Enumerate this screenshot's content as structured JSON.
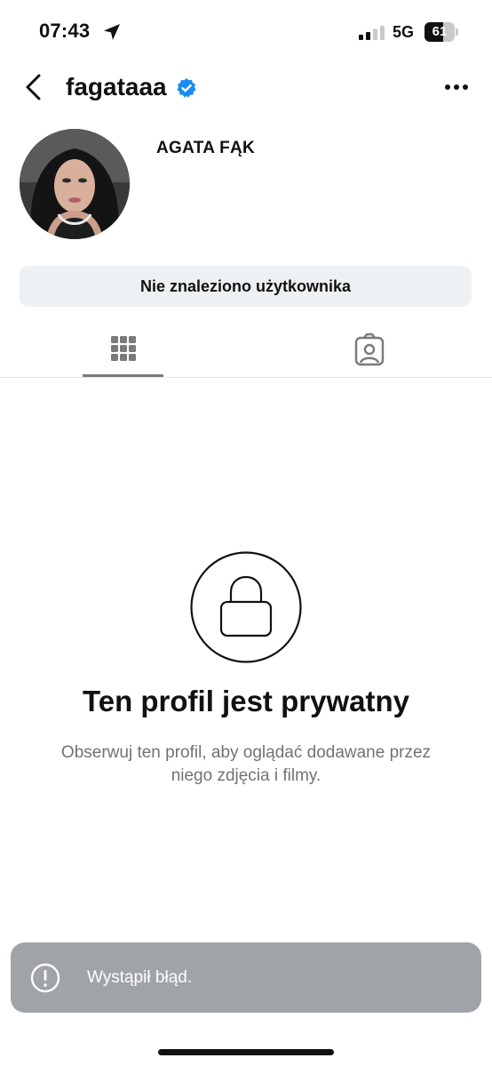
{
  "status_bar": {
    "time": "07:43",
    "network": "5G",
    "battery": "61",
    "battery_level": 0.61
  },
  "header": {
    "username": "fagataaa",
    "verified": true
  },
  "profile": {
    "full_name": "AGATA FĄK",
    "action_button_label": "Nie znaleziono użytkownika"
  },
  "tabs": [
    {
      "icon": "grid-icon",
      "active": true
    },
    {
      "icon": "tagged-icon",
      "active": false
    }
  ],
  "private": {
    "title": "Ten profil jest prywatny",
    "description": "Obserwuj ten profil, aby oglądać dodawane przez niego zdjęcia i filmy."
  },
  "toast": {
    "message": "Wystąpił błąd."
  },
  "colors": {
    "verified": "#1a8cf0",
    "toast_bg": "#a0a4a8",
    "button_bg": "#eef1f4"
  }
}
